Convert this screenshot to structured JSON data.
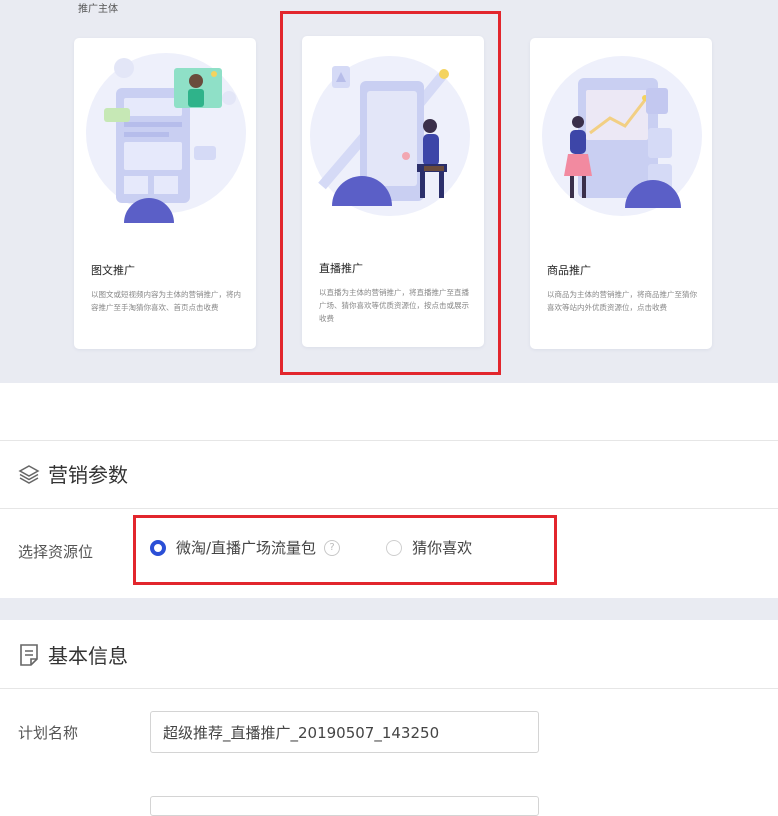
{
  "promo": {
    "section_label": "推广主体",
    "cards": [
      {
        "title": "图文推广",
        "desc": "以图文或短视频内容为主体的营销推广，将内容推广至手淘猜你喜欢、首页点击收费"
      },
      {
        "title": "直播推广",
        "desc": "以直播为主体的营销推广，将直播推广至直播广场、猜你喜欢等优质资源位，按点击或展示收费"
      },
      {
        "title": "商品推广",
        "desc": "以商品为主体的营销推广，将商品推广至猜你喜欢等站内外优质资源位，点击收费"
      }
    ]
  },
  "marketing": {
    "title": "营销参数",
    "resource_label": "选择资源位",
    "options": [
      "微淘/直播广场流量包",
      "猜你喜欢"
    ],
    "help_glyph": "?"
  },
  "basic": {
    "title": "基本信息",
    "plan_name_label": "计划名称",
    "plan_name_value": "超级推荐_直播推广_20190507_143250"
  },
  "colors": {
    "accent": "#2b4fd6",
    "highlight": "#e2262d",
    "panel_bg": "#e9ebf2"
  }
}
